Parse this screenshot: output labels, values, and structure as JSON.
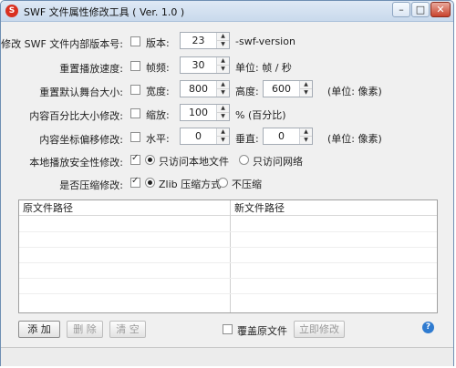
{
  "window": {
    "title": "SWF 文件属性修改工具 ( Ver. 1.0 )",
    "icon_glyph": "S",
    "buttons": {
      "minimize": "–",
      "maximize": "□",
      "close": "✕"
    }
  },
  "rows": {
    "version": {
      "label": "修改 SWF 文件内部版本号:",
      "check_label": "版本:",
      "value": "23",
      "suffix": "-swf-version"
    },
    "fps": {
      "label": "重置播放速度:",
      "check_label": "帧频:",
      "value": "30",
      "suffix": "单位: 帧 / 秒"
    },
    "size": {
      "label": "重置默认舞台大小:",
      "check_label": "宽度:",
      "width": "800",
      "height_label": "高度:",
      "height": "600",
      "suffix": "(单位: 像素)"
    },
    "scale": {
      "label": "内容百分比大小修改:",
      "check_label": "缩放:",
      "value": "100",
      "suffix": "% (百分比)"
    },
    "offset": {
      "label": "内容坐标偏移修改:",
      "check_label": "水平:",
      "x": "0",
      "y_label": "垂直:",
      "y": "0",
      "suffix": "(单位: 像素)"
    },
    "security": {
      "label": "本地播放安全性修改:",
      "opt_local": "只访问本地文件",
      "opt_network": "只访问网络"
    },
    "compress": {
      "label": "是否压缩修改:",
      "opt_zlib": "Zlib 压缩方式",
      "opt_none": "不压缩"
    }
  },
  "table": {
    "col_source": "原文件路径",
    "col_new": "新文件路径"
  },
  "footer": {
    "add": "添 加",
    "delete": "删 除",
    "clear": "清 空",
    "overwrite": "覆盖原文件",
    "apply": "立即修改",
    "help": "?"
  }
}
